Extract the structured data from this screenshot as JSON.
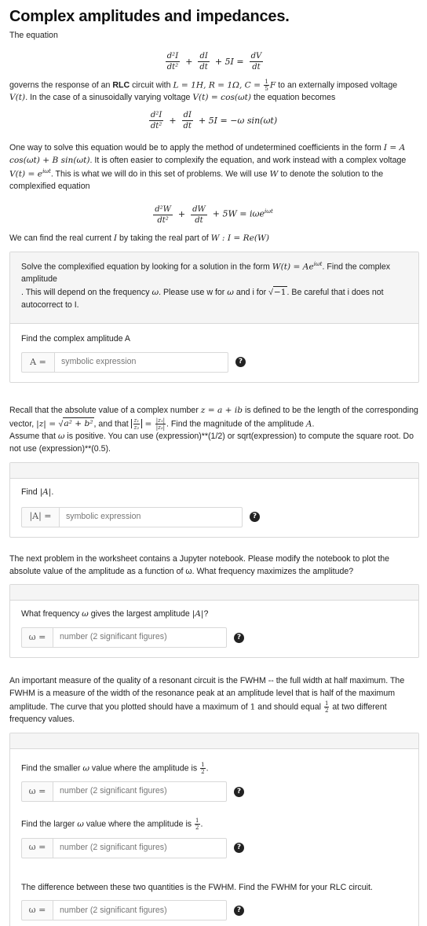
{
  "title": "Complex amplitudes and impedances.",
  "intro": {
    "lead": "The equation",
    "eq1": {
      "d2I": "d²I",
      "dt2": "dt²",
      "dI": "dI",
      "dt": "dt",
      "plus1": "+",
      "plus2": "+ 5I =",
      "dV": "dV",
      "dt2b": "dt"
    },
    "governs_a": "governs the response of an ",
    "rlc": "RLC",
    "governs_b": " circuit with ",
    "params": "L = 1H, R = 1Ω, C = ",
    "c_num": "1",
    "c_den": "5",
    "c_unit": "F",
    "governs_c": " to an externally imposed voltage ",
    "vt": "V(t)",
    "governs_d": ". In the case of a sinusoidally varying voltage ",
    "vt2": "V(t) = cos(ωt)",
    "governs_e": " the equation becomes",
    "eq2_rhs": "+ 5I = −ω sin(ωt)",
    "p2_a": "One way to solve this equation would be to apply the method of undetermined coefficients in the form ",
    "p2_form": "I = A cos(ωt) + B sin(ωt)",
    "p2_b": ". It is often easier to complexify the equation, and work instead with a complex voltage ",
    "p2_v": "V(t) = e",
    "p2_v_sup": "iωt",
    "p2_c": ". This is what we will do in this set of problems. We will use ",
    "p2_w": "W",
    "p2_d": " to denote the solution to the complexified equation",
    "eq3_d2W": "d²W",
    "eq3_dW": "dW",
    "eq3_rhs": "+ 5W = iωe",
    "eq3_sup": "iωt",
    "p3_a": "We can find the real current ",
    "p3_i": "I",
    "p3_b": " by taking the real part of ",
    "p3_w": "W : I = Re(W)"
  },
  "q1": {
    "head_a": "Solve the complexified equation by looking for a solution in the form ",
    "head_form": "W(t) = Ae",
    "head_sup": "iωt",
    "head_b": ". Find the complex amplitude ",
    "head_A": "A",
    "head_c": ". This will depend on the frequency ",
    "head_omega": "ω",
    "head_d": ". Please use w for ",
    "head_omega2": "ω",
    "head_e": " and i for ",
    "head_sqrt": "−1",
    "head_f": ". Be careful that i does not autocorrect to I.",
    "prompt": "Find the complex amplitude A",
    "label": "A =",
    "placeholder": "symbolic expression"
  },
  "recall": {
    "a": "Recall that the absolute value of a complex number ",
    "z": "z = a + ib",
    "b": " is defined to be the length of the corresponding vector, ",
    "absz": "|z| = ",
    "sqrt_in": "a² + b²",
    "c": ", and that ",
    "d": ". Find the magnitude of the amplitude ",
    "A": "A",
    "e": ".",
    "f": "Assume that ",
    "omega": "ω",
    "g": " is positive. You can use (expression)**(1/2) or sqrt(expression) to compute the square root. Do not use (expression)**(0.5).",
    "z1": "z₁",
    "z2": "z₂",
    "absz1": "|z₁|",
    "absz2": "|z₂|"
  },
  "q2": {
    "prompt_a": "Find ",
    "prompt_abs": "|A|",
    "prompt_b": ".",
    "label": "|A| =",
    "placeholder": "symbolic expression"
  },
  "p4": "The next problem in the worksheet contains a Jupyter notebook. Please modify the notebook to plot the absolute value of the amplitude as a function of ω. What frequency maximizes the amplitude?",
  "q3": {
    "prompt_a": "What frequency ",
    "omega": "ω",
    "prompt_b": " gives the largest amplitude ",
    "abs": "|A|",
    "prompt_c": "?",
    "label": "ω =",
    "placeholder": "number (2 significant figures)"
  },
  "p5_a": "An important measure of the quality of a resonant circuit is the FWHM -- the full width at half maximum. The FWHM is a measure of the width of the resonance peak at an amplitude level that is half of the maximum amplitude. The curve that you plotted should have a maximum of ",
  "p5_one": "1",
  "p5_b": " and should equal ",
  "p5_c": " at two different frequency values.",
  "q4": {
    "prompt_a": "Find the smaller ",
    "omega": "ω",
    "prompt_b": " value where the amplitude is ",
    "label": "ω =",
    "placeholder": "number (2 significant figures)"
  },
  "q5": {
    "prompt_a": "Find the larger ",
    "omega": "ω",
    "prompt_b": " value where the amplitude is ",
    "label": "ω =",
    "placeholder": "number (2 significant figures)"
  },
  "q6": {
    "prompt": "The difference between these two quantities is the FWHM. Find the FWHM for your RLC circuit.",
    "label": "ω =",
    "placeholder": "number (2 significant figures)"
  },
  "half_num": "1",
  "half_den": "2",
  "help_glyph": "?",
  "colors": {
    "box_head": "#f5f5f5",
    "border": "#d9d9d9",
    "help": "#222222"
  }
}
